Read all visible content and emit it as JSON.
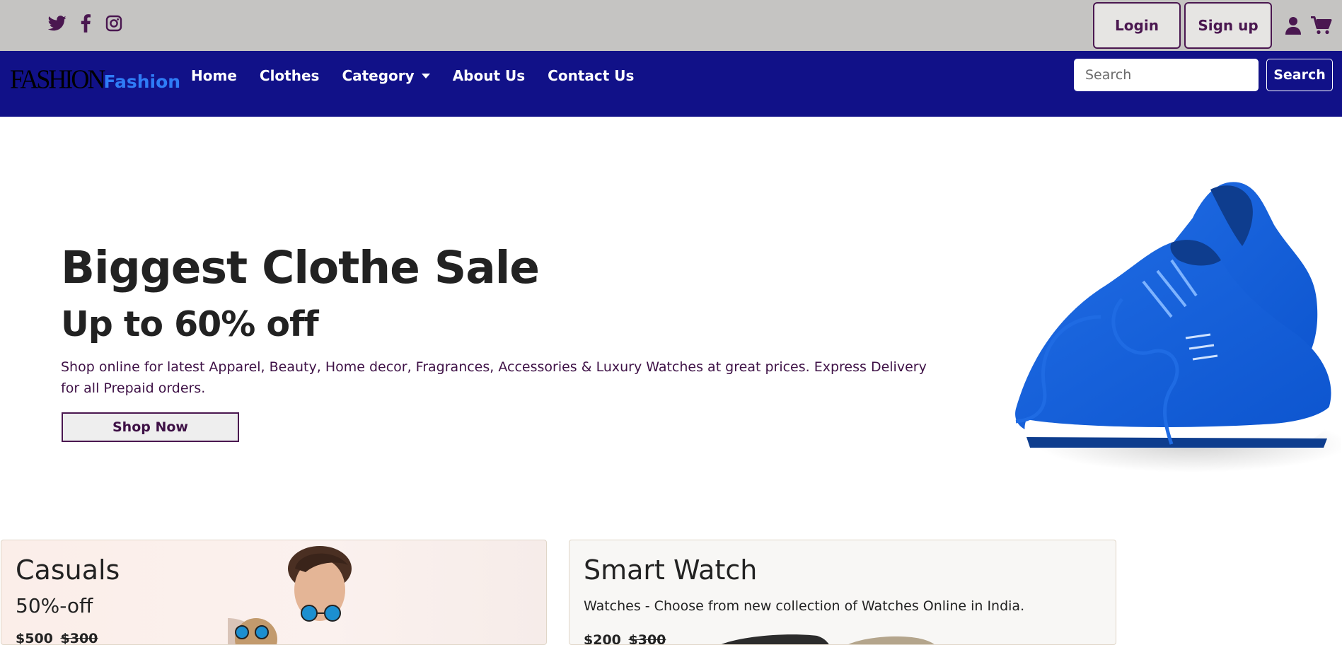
{
  "topbar": {
    "social": [
      "twitter-icon",
      "facebook-icon",
      "instagram-icon"
    ],
    "login_label": "Login",
    "signup_label": "Sign up",
    "icons": [
      "user-icon",
      "cart-icon"
    ]
  },
  "navbar": {
    "brand_logo": "FASHION",
    "brand_text": "Fashion",
    "links": [
      "Home",
      "Clothes",
      "Category",
      "About Us",
      "Contact Us"
    ],
    "search_placeholder": "Search",
    "search_button": "Search"
  },
  "hero": {
    "title": "Biggest Clothe Sale",
    "subtitle": "Up to 60% off",
    "description": "Shop online for latest Apparel, Beauty, Home decor, Fragrances, Accessories & Luxury Watches at great prices. Express Delivery for all Prepaid orders.",
    "button": "Shop Now"
  },
  "cards": [
    {
      "title": "Casuals",
      "subtitle": "50%-off",
      "price": "$500",
      "old_price": "$300"
    },
    {
      "title": "Smart Watch",
      "text": "Watches - Choose from new collection of Watches Online in India.",
      "price": "$200",
      "old_price": "$300"
    }
  ],
  "colors": {
    "topbar_bg": "#c5c4c2",
    "navbar_bg": "#111188",
    "accent_purple": "#4a1750",
    "brand_blue": "#2f7cf6"
  }
}
